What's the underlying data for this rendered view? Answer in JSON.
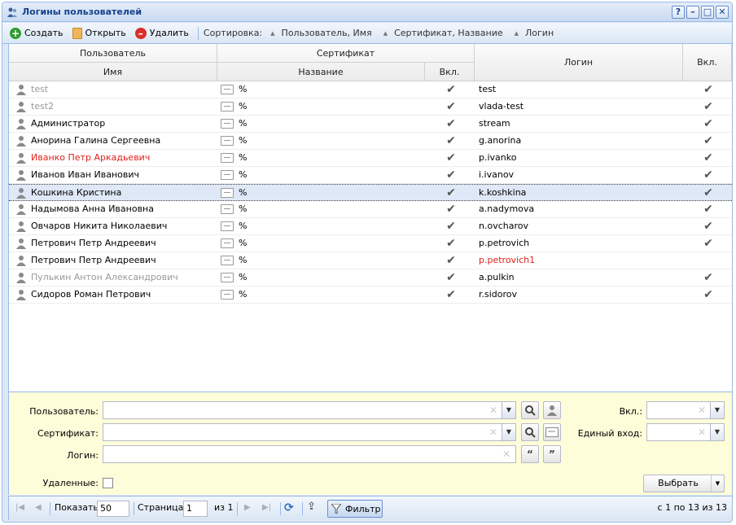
{
  "window": {
    "title": "Логины пользователей",
    "tools": [
      "?",
      "–",
      "□",
      "✕"
    ]
  },
  "toolbar": {
    "create": "Создать",
    "open": "Открыть",
    "delete": "Удалить",
    "sort_label": "Сортировка:",
    "sort_items": [
      "Пользователь, Имя",
      "Сертификат, Название",
      "Логин"
    ]
  },
  "grid": {
    "headers": {
      "user_group": "Пользователь",
      "user_name": "Имя",
      "cert_group": "Сертификат",
      "cert_name": "Название",
      "cert_enabled": "Вкл.",
      "login": "Логин",
      "enabled": "Вкл."
    },
    "rows": [
      {
        "name": "test",
        "cert": "%",
        "cert_on": "✔",
        "login": "test",
        "on": "✔"
      },
      {
        "name": "test2",
        "cert": "%",
        "cert_on": "✔",
        "login": "vlada-test",
        "on": "✔"
      },
      {
        "name": "Администратор",
        "cert": "%",
        "cert_on": "✔",
        "login": "stream",
        "on": "✔"
      },
      {
        "name": "Анорина Галина Сергеевна",
        "cert": "%",
        "cert_on": "✔",
        "login": "g.anorina",
        "on": "✔"
      },
      {
        "name": "Иванко Петр Аркадьевич",
        "cert": "%",
        "cert_on": "✔",
        "login": "p.ivanko",
        "on": "✔"
      },
      {
        "name": "Иванов Иван Иванович",
        "cert": "%",
        "cert_on": "✔",
        "login": "i.ivanov",
        "on": "✔"
      },
      {
        "name": "Кошкина Кристина",
        "cert": "%",
        "cert_on": "✔",
        "login": "k.koshkina",
        "on": "✔"
      },
      {
        "name": "Надымова Анна Ивановна",
        "cert": "%",
        "cert_on": "✔",
        "login": "a.nadymova",
        "on": "✔"
      },
      {
        "name": "Овчаров Никита Николаевич",
        "cert": "%",
        "cert_on": "✔",
        "login": "n.ovcharov",
        "on": "✔"
      },
      {
        "name": "Петрович Петр Андреевич",
        "cert": "%",
        "cert_on": "✔",
        "login": "p.petrovich",
        "on": "✔"
      },
      {
        "name": "Петрович Петр Андреевич",
        "cert": "%",
        "cert_on": "✔",
        "login": "p.petrovich1",
        "on": ""
      },
      {
        "name": "Пулькин Антон Александрович",
        "cert": "%",
        "cert_on": "✔",
        "login": "a.pulkin",
        "on": "✔"
      },
      {
        "name": "Сидоров Роман Петрович",
        "cert": "%",
        "cert_on": "✔",
        "login": "r.sidorov",
        "on": "✔"
      }
    ]
  },
  "filter": {
    "user_label": "Пользователь:",
    "cert_label": "Сертификат:",
    "login_label": "Логин:",
    "deleted_label": "Удаленные:",
    "enabled_label": "Вкл.:",
    "sso_label": "Единый вход:",
    "select_button": "Выбрать"
  },
  "pager": {
    "show_label": "Показать",
    "page_size": "50",
    "page_label": "Страница",
    "page": "1",
    "of_label": "из 1",
    "filter_button": "Фильтр",
    "summary": "с 1 по 13 из 13"
  },
  "colors": {
    "accent": "#15428b",
    "panel_border": "#99bbe8",
    "filter_bg": "#fefdd9",
    "warning_red": "#e0201c",
    "muted_grey": "#999999"
  }
}
